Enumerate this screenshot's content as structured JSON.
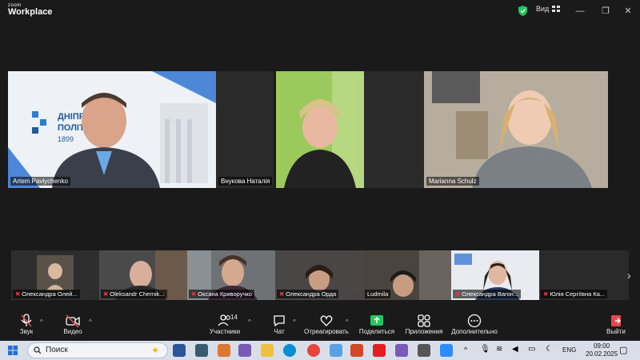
{
  "app": {
    "logo_small": "zoom",
    "logo_big": "Workplace",
    "view_label": "Вид"
  },
  "main_participants": [
    {
      "name": "Artem Pavlychenko",
      "bg": "#4a6e8a"
    },
    {
      "name": "Внукова Наталія",
      "bg": "#3b3b3b"
    },
    {
      "name": "Marianna Schulz",
      "bg": "#8a8276"
    }
  ],
  "gallery": [
    {
      "name": "Олександра Олей..."
    },
    {
      "name": "Oleksandr Chernik..."
    },
    {
      "name": "Оксана Криворучко"
    },
    {
      "name": "Олександра Орда"
    },
    {
      "name": "Ludmila"
    },
    {
      "name": "Олександра Вагон..."
    },
    {
      "name": "Юлія Сергіївна Ка..."
    }
  ],
  "toolbar": {
    "audio": "Звук",
    "video": "Видео",
    "participants": "Участники",
    "participants_count": "14",
    "chat": "Чат",
    "react": "Отреагировать",
    "share": "Поделиться",
    "apps": "Приложения",
    "more": "Дополнительно",
    "leave": "Выйти"
  },
  "taskbar": {
    "search_placeholder": "Поиск",
    "lang": "ENG",
    "time": "09:00",
    "date": "20.02.2025"
  },
  "colors": {
    "active_speaker": "#3ddc97",
    "muted": "#e33333",
    "share_green": "#22c55e",
    "leave_red": "#e5484d"
  }
}
